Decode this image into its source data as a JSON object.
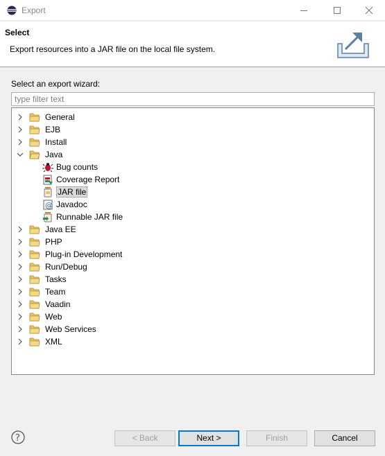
{
  "window": {
    "title": "Export"
  },
  "header": {
    "title": "Select",
    "description": "Export resources into a JAR file on the local file system."
  },
  "wizard": {
    "label": "Select an export wizard:",
    "filter_placeholder": "type filter text",
    "tree": [
      {
        "label": "General",
        "expanded": false
      },
      {
        "label": "EJB",
        "expanded": false
      },
      {
        "label": "Install",
        "expanded": false
      },
      {
        "label": "Java",
        "expanded": true,
        "children": [
          {
            "label": "Bug counts",
            "icon": "bug-counts-icon"
          },
          {
            "label": "Coverage Report",
            "icon": "coverage-report-icon"
          },
          {
            "label": "JAR file",
            "icon": "jar-file-icon",
            "selected": true
          },
          {
            "label": "Javadoc",
            "icon": "javadoc-icon"
          },
          {
            "label": "Runnable JAR file",
            "icon": "runnable-jar-icon"
          }
        ]
      },
      {
        "label": "Java EE",
        "expanded": false
      },
      {
        "label": "PHP",
        "expanded": false
      },
      {
        "label": "Plug-in Development",
        "expanded": false
      },
      {
        "label": "Run/Debug",
        "expanded": false
      },
      {
        "label": "Tasks",
        "expanded": false
      },
      {
        "label": "Team",
        "expanded": false
      },
      {
        "label": "Vaadin",
        "expanded": false
      },
      {
        "label": "Web",
        "expanded": false
      },
      {
        "label": "Web Services",
        "expanded": false
      },
      {
        "label": "XML",
        "expanded": false
      }
    ]
  },
  "buttons": {
    "back": "< Back",
    "next": "Next >",
    "finish": "Finish",
    "cancel": "Cancel"
  },
  "colors": {
    "accent": "#0078d7",
    "folder": "#e8c36a",
    "selection": "#d9d9d9"
  }
}
